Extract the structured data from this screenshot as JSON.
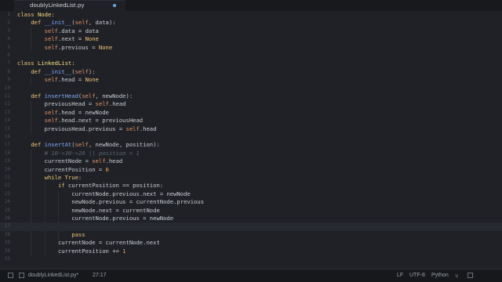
{
  "tab": {
    "title": "doublyLinkedList.py"
  },
  "status": {
    "file": "doublyLinkedList.py*",
    "cursor": "27:17",
    "line_ending": "LF",
    "encoding": "UTF-8",
    "grammar": "Python"
  },
  "lines": [
    {
      "n": "1",
      "t": "class Node:"
    },
    {
      "n": "2",
      "t": "    def __init__(self, data):"
    },
    {
      "n": "3",
      "t": "        self.data = data"
    },
    {
      "n": "4",
      "t": "        self.next = None"
    },
    {
      "n": "5",
      "t": "        self.previous = None"
    },
    {
      "n": "6",
      "t": ""
    },
    {
      "n": "7",
      "t": "class LinkedList:"
    },
    {
      "n": "8",
      "t": "    def __init__(self):"
    },
    {
      "n": "9",
      "t": "        self.head = None"
    },
    {
      "n": "10",
      "t": ""
    },
    {
      "n": "11",
      "t": "    def insertHead(self, newNode):"
    },
    {
      "n": "12",
      "t": "        previousHead = self.head"
    },
    {
      "n": "13",
      "t": "        self.head = newNode"
    },
    {
      "n": "14",
      "t": "        self.head.next = previousHead"
    },
    {
      "n": "15",
      "t": "        previousHead.previous = self.head"
    },
    {
      "n": "16",
      "t": ""
    },
    {
      "n": "17",
      "t": "    def insertAt(self, newNode, position):"
    },
    {
      "n": "18",
      "t": "        # 10->30->20 || position = 1"
    },
    {
      "n": "19",
      "t": "        currentNode = self.head"
    },
    {
      "n": "20",
      "t": "        currentPosition = 0"
    },
    {
      "n": "21",
      "t": "        while True:"
    },
    {
      "n": "22",
      "t": "            if currentPosition == position:"
    },
    {
      "n": "23",
      "t": "                currentNode.previous.next = newNode"
    },
    {
      "n": "24",
      "t": "                newNode.previous = currentNode.previous"
    },
    {
      "n": "25",
      "t": "                newNode.next = currentNode"
    },
    {
      "n": "26",
      "t": "                currentNode.previous = newNode"
    },
    {
      "n": "27",
      "t": ""
    },
    {
      "n": "28",
      "t": "                pass"
    },
    {
      "n": "29",
      "t": "            currentNode = currentNode.next"
    },
    {
      "n": "30",
      "t": "            currentPosition += 1"
    },
    {
      "n": "31",
      "t": ""
    }
  ],
  "current_line": 27
}
